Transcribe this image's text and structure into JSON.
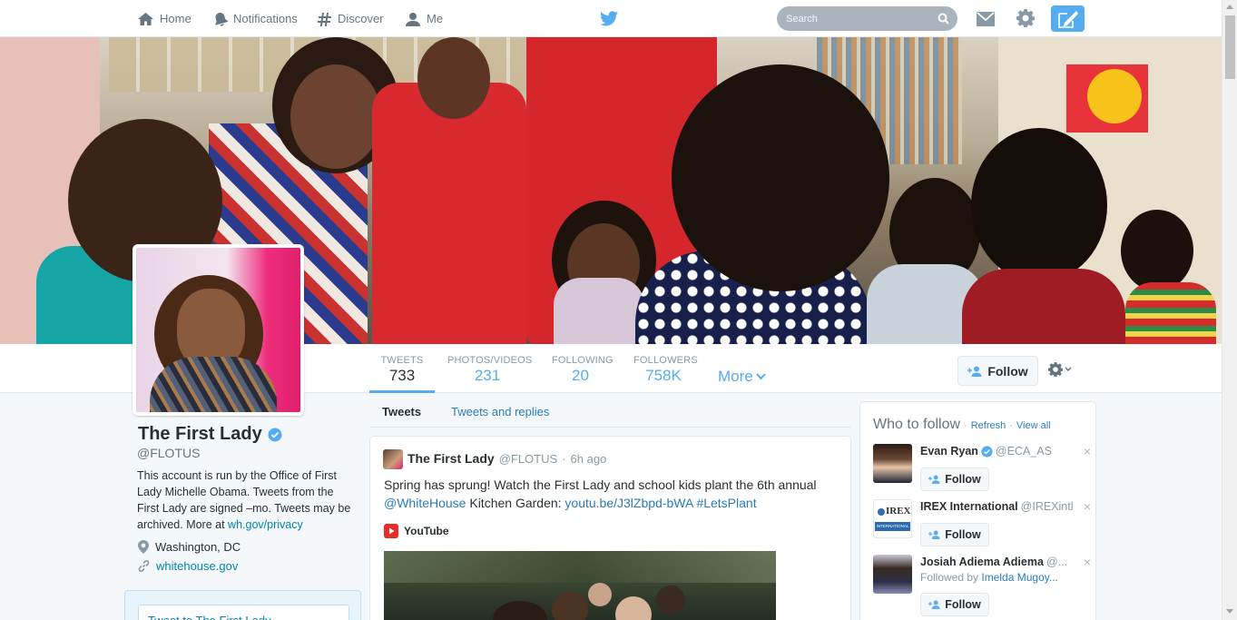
{
  "nav": {
    "home": "Home",
    "notifications": "Notifications",
    "discover": "Discover",
    "me": "Me",
    "search_placeholder": "Search"
  },
  "stats": {
    "tweets_label": "TWEETS",
    "tweets_value": "733",
    "photos_label": "PHOTOS/VIDEOS",
    "photos_value": "231",
    "following_label": "FOLLOWING",
    "following_value": "20",
    "followers_label": "FOLLOWERS",
    "followers_value": "758K",
    "more_label": "More"
  },
  "profile": {
    "follow_label": "Follow",
    "name": "The First Lady",
    "handle": "@FLOTUS",
    "bio_text": "This account is run by the Office of First Lady Michelle Obama. Tweets from the First Lady are signed –mo. Tweets may be archived. More at ",
    "bio_link": "wh.gov/privacy",
    "location": "Washington, DC",
    "website": "whitehouse.gov",
    "tweet_to_placeholder": "Tweet to The First Lady"
  },
  "tabs": {
    "tweets": "Tweets",
    "tweets_and_replies": "Tweets and replies"
  },
  "tweet": {
    "name": "The First Lady",
    "handle": "@FLOTUS",
    "sep": "·",
    "time": "6h ago",
    "text_1": "Spring has sprung! Watch the First Lady and school kids plant the 6th annual ",
    "mention": "@WhiteHouse",
    "text_2": " Kitchen Garden: ",
    "link": "youtu.be/J3lZbpd-bWA",
    "hashtag": "#LetsPlant",
    "card_source": "YouTube"
  },
  "who_to_follow": {
    "title": "Who to follow",
    "dot1": "·",
    "refresh": "Refresh",
    "dot2": "·",
    "view_all": "View all",
    "suggestions": [
      {
        "name": "Evan Ryan",
        "handle": "@ECA_AS",
        "follow": "Follow",
        "close": "×"
      },
      {
        "name": "IREX International",
        "handle": "@IREXintl",
        "follow": "Follow",
        "close": "×",
        "logo_text": "IREX",
        "logo_sub": "INTERNATIONAL"
      },
      {
        "name": "Josiah Adiema Adiema",
        "handle": "@...",
        "followed_by": "Followed by ",
        "followed_by_name": "Imelda Mugoy...",
        "follow": "Follow",
        "close": "×"
      }
    ]
  },
  "colors": {
    "accent": "#55acee",
    "link": "#2b7bb9",
    "verified": "#55acee"
  }
}
